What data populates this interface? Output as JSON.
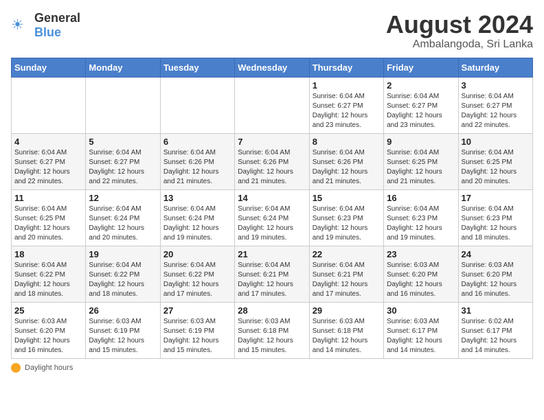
{
  "logo": {
    "text_general": "General",
    "text_blue": "Blue"
  },
  "title": {
    "month_year": "August 2024",
    "location": "Ambalangoda, Sri Lanka"
  },
  "days_of_week": [
    "Sunday",
    "Monday",
    "Tuesday",
    "Wednesday",
    "Thursday",
    "Friday",
    "Saturday"
  ],
  "footer": {
    "daylight_label": "Daylight hours"
  },
  "weeks": [
    [
      {
        "day": "",
        "sunrise": "",
        "sunset": "",
        "daylight": ""
      },
      {
        "day": "",
        "sunrise": "",
        "sunset": "",
        "daylight": ""
      },
      {
        "day": "",
        "sunrise": "",
        "sunset": "",
        "daylight": ""
      },
      {
        "day": "",
        "sunrise": "",
        "sunset": "",
        "daylight": ""
      },
      {
        "day": "1",
        "sunrise": "Sunrise: 6:04 AM",
        "sunset": "Sunset: 6:27 PM",
        "daylight": "Daylight: 12 hours and 23 minutes."
      },
      {
        "day": "2",
        "sunrise": "Sunrise: 6:04 AM",
        "sunset": "Sunset: 6:27 PM",
        "daylight": "Daylight: 12 hours and 23 minutes."
      },
      {
        "day": "3",
        "sunrise": "Sunrise: 6:04 AM",
        "sunset": "Sunset: 6:27 PM",
        "daylight": "Daylight: 12 hours and 22 minutes."
      }
    ],
    [
      {
        "day": "4",
        "sunrise": "Sunrise: 6:04 AM",
        "sunset": "Sunset: 6:27 PM",
        "daylight": "Daylight: 12 hours and 22 minutes."
      },
      {
        "day": "5",
        "sunrise": "Sunrise: 6:04 AM",
        "sunset": "Sunset: 6:27 PM",
        "daylight": "Daylight: 12 hours and 22 minutes."
      },
      {
        "day": "6",
        "sunrise": "Sunrise: 6:04 AM",
        "sunset": "Sunset: 6:26 PM",
        "daylight": "Daylight: 12 hours and 21 minutes."
      },
      {
        "day": "7",
        "sunrise": "Sunrise: 6:04 AM",
        "sunset": "Sunset: 6:26 PM",
        "daylight": "Daylight: 12 hours and 21 minutes."
      },
      {
        "day": "8",
        "sunrise": "Sunrise: 6:04 AM",
        "sunset": "Sunset: 6:26 PM",
        "daylight": "Daylight: 12 hours and 21 minutes."
      },
      {
        "day": "9",
        "sunrise": "Sunrise: 6:04 AM",
        "sunset": "Sunset: 6:25 PM",
        "daylight": "Daylight: 12 hours and 21 minutes."
      },
      {
        "day": "10",
        "sunrise": "Sunrise: 6:04 AM",
        "sunset": "Sunset: 6:25 PM",
        "daylight": "Daylight: 12 hours and 20 minutes."
      }
    ],
    [
      {
        "day": "11",
        "sunrise": "Sunrise: 6:04 AM",
        "sunset": "Sunset: 6:25 PM",
        "daylight": "Daylight: 12 hours and 20 minutes."
      },
      {
        "day": "12",
        "sunrise": "Sunrise: 6:04 AM",
        "sunset": "Sunset: 6:24 PM",
        "daylight": "Daylight: 12 hours and 20 minutes."
      },
      {
        "day": "13",
        "sunrise": "Sunrise: 6:04 AM",
        "sunset": "Sunset: 6:24 PM",
        "daylight": "Daylight: 12 hours and 19 minutes."
      },
      {
        "day": "14",
        "sunrise": "Sunrise: 6:04 AM",
        "sunset": "Sunset: 6:24 PM",
        "daylight": "Daylight: 12 hours and 19 minutes."
      },
      {
        "day": "15",
        "sunrise": "Sunrise: 6:04 AM",
        "sunset": "Sunset: 6:23 PM",
        "daylight": "Daylight: 12 hours and 19 minutes."
      },
      {
        "day": "16",
        "sunrise": "Sunrise: 6:04 AM",
        "sunset": "Sunset: 6:23 PM",
        "daylight": "Daylight: 12 hours and 19 minutes."
      },
      {
        "day": "17",
        "sunrise": "Sunrise: 6:04 AM",
        "sunset": "Sunset: 6:23 PM",
        "daylight": "Daylight: 12 hours and 18 minutes."
      }
    ],
    [
      {
        "day": "18",
        "sunrise": "Sunrise: 6:04 AM",
        "sunset": "Sunset: 6:22 PM",
        "daylight": "Daylight: 12 hours and 18 minutes."
      },
      {
        "day": "19",
        "sunrise": "Sunrise: 6:04 AM",
        "sunset": "Sunset: 6:22 PM",
        "daylight": "Daylight: 12 hours and 18 minutes."
      },
      {
        "day": "20",
        "sunrise": "Sunrise: 6:04 AM",
        "sunset": "Sunset: 6:22 PM",
        "daylight": "Daylight: 12 hours and 17 minutes."
      },
      {
        "day": "21",
        "sunrise": "Sunrise: 6:04 AM",
        "sunset": "Sunset: 6:21 PM",
        "daylight": "Daylight: 12 hours and 17 minutes."
      },
      {
        "day": "22",
        "sunrise": "Sunrise: 6:04 AM",
        "sunset": "Sunset: 6:21 PM",
        "daylight": "Daylight: 12 hours and 17 minutes."
      },
      {
        "day": "23",
        "sunrise": "Sunrise: 6:03 AM",
        "sunset": "Sunset: 6:20 PM",
        "daylight": "Daylight: 12 hours and 16 minutes."
      },
      {
        "day": "24",
        "sunrise": "Sunrise: 6:03 AM",
        "sunset": "Sunset: 6:20 PM",
        "daylight": "Daylight: 12 hours and 16 minutes."
      }
    ],
    [
      {
        "day": "25",
        "sunrise": "Sunrise: 6:03 AM",
        "sunset": "Sunset: 6:20 PM",
        "daylight": "Daylight: 12 hours and 16 minutes."
      },
      {
        "day": "26",
        "sunrise": "Sunrise: 6:03 AM",
        "sunset": "Sunset: 6:19 PM",
        "daylight": "Daylight: 12 hours and 15 minutes."
      },
      {
        "day": "27",
        "sunrise": "Sunrise: 6:03 AM",
        "sunset": "Sunset: 6:19 PM",
        "daylight": "Daylight: 12 hours and 15 minutes."
      },
      {
        "day": "28",
        "sunrise": "Sunrise: 6:03 AM",
        "sunset": "Sunset: 6:18 PM",
        "daylight": "Daylight: 12 hours and 15 minutes."
      },
      {
        "day": "29",
        "sunrise": "Sunrise: 6:03 AM",
        "sunset": "Sunset: 6:18 PM",
        "daylight": "Daylight: 12 hours and 14 minutes."
      },
      {
        "day": "30",
        "sunrise": "Sunrise: 6:03 AM",
        "sunset": "Sunset: 6:17 PM",
        "daylight": "Daylight: 12 hours and 14 minutes."
      },
      {
        "day": "31",
        "sunrise": "Sunrise: 6:02 AM",
        "sunset": "Sunset: 6:17 PM",
        "daylight": "Daylight: 12 hours and 14 minutes."
      }
    ]
  ]
}
